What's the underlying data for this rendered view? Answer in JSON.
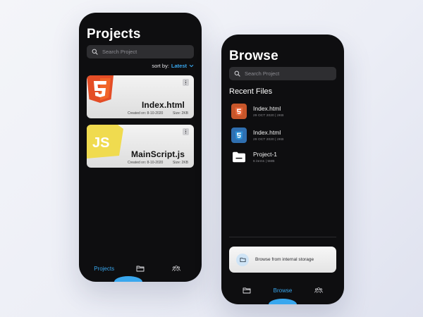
{
  "projects_screen": {
    "title": "Projects",
    "search": {
      "placeholder": "Search Project"
    },
    "sort": {
      "label": "sort by:",
      "value": "Latest"
    },
    "cards": [
      {
        "file_name": "Index.html",
        "created": "Created on: 8-10-2020",
        "size": "Size: 2KB",
        "logo": "html5-icon",
        "logo_color": "#e44d26"
      },
      {
        "file_name": "MainScript.js",
        "created": "Created on: 8-10-2020",
        "size": "Size: 2KB",
        "logo": "javascript-icon",
        "logo_color": "#f0db4f",
        "logo_text": "JS"
      }
    ],
    "nav": {
      "projects_label": "Projects",
      "folder_icon": "folder-icon",
      "people_icon": "people-icon"
    }
  },
  "browse_screen": {
    "title": "Browse",
    "search": {
      "placeholder": "Search Project"
    },
    "section_title": "Recent Files",
    "recent_files": [
      {
        "name": "Index.html",
        "meta": "29 OCT 2020  | 2KB",
        "icon": "html5-icon",
        "color": "#c7562a"
      },
      {
        "name": "Index.html",
        "meta": "29 OCT 2020  | 2KB",
        "icon": "css3-icon",
        "color": "#2f6fb0"
      },
      {
        "name": "Project-1",
        "meta": "6 items  | 5MB",
        "icon": "folder-icon",
        "color": "#ffffff"
      }
    ],
    "storage_button": {
      "label": "Browse from internal storage"
    },
    "nav": {
      "browse_label": "Browse",
      "folder_icon": "folder-icon",
      "people_icon": "people-icon"
    }
  },
  "colors": {
    "accent": "#39a7ee",
    "phone_bg": "#0e0e10",
    "search_bg": "#2e2e31"
  }
}
